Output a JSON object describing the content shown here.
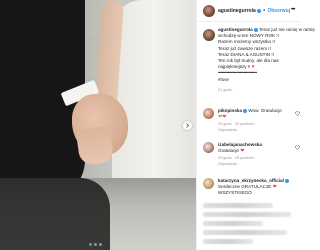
{
  "post": {
    "carousel": {
      "slides": 3,
      "active_index": 0
    },
    "header": {
      "username": "agustinegurrola",
      "separator": "•",
      "follow_label": "Obserwuj"
    },
    "caption": {
      "username": "agustinegurrola",
      "lines": [
        "Teraz już nie ramię w ramię",
        "wchodzę w ten NOWY ROK !!",
        "Razem możemy wszystko !!",
        "Teraz już zawsze razem !!",
        "Teraz DIANA & AGUSTIN !!",
        "Ten rok był trudny, ale dla nas",
        "najpiękniejszy !!"
      ],
      "separator_line": "••••••••••••••••••••••••••••••••",
      "hashtag": "#love",
      "time": "21 godz."
    },
    "comments": [
      {
        "username": "piknpinska",
        "text": "Wow. Gratulacje",
        "time": "20 godz.",
        "likes": "25 polubień",
        "reply": "Odpowiedz"
      },
      {
        "username": "izabelajanachowska",
        "text": "Gratulacje",
        "time": "20 godz.",
        "likes": "29 polubień",
        "reply": "Odpowiedz"
      },
      {
        "username": "katarzyna_skrzynecka_official",
        "text": "Serdeczne GRATULACJE",
        "text_cont": "WSZYSTKIEGO",
        "time": "",
        "likes": "",
        "reply": ""
      }
    ],
    "colors": {
      "link": "#3897f0",
      "heart": "#ed4956",
      "meta": "#999999"
    }
  }
}
